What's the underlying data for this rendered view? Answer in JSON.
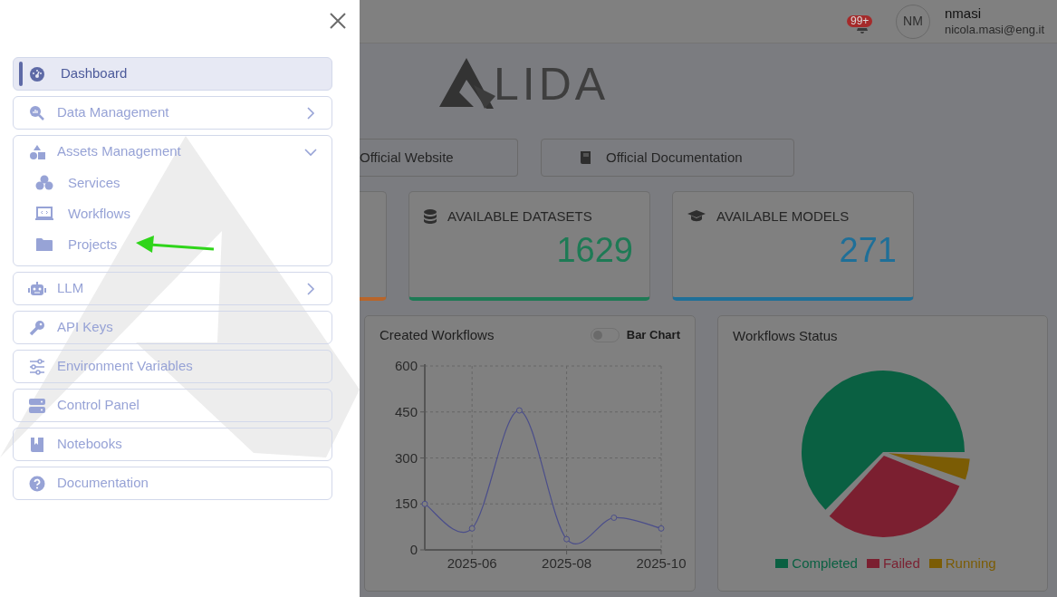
{
  "nav": [
    {
      "label": "Dashboard",
      "selected": true
    },
    {
      "label": "Data Management",
      "selected": false,
      "expandable": true,
      "expanded": false
    },
    {
      "label": "Assets Management",
      "selected": false,
      "expandable": true,
      "expanded": true,
      "children": [
        {
          "label": "Services",
          "selected": false
        },
        {
          "label": "Workflows",
          "selected": false
        },
        {
          "label": "Projects",
          "selected": false
        }
      ]
    },
    {
      "label": "LLM",
      "selected": false,
      "expandable": true,
      "expanded": false
    },
    {
      "label": "API Keys",
      "selected": false
    },
    {
      "label": "Environment Variables",
      "selected": false
    },
    {
      "label": "Control Panel",
      "selected": false
    },
    {
      "label": "Notebooks",
      "selected": false
    },
    {
      "label": "Documentation",
      "selected": false
    }
  ],
  "header": {
    "notification_badge": "99+",
    "avatar_initials": "NM",
    "user_name": "nmasi",
    "user_email": "nicola.masi@eng.it"
  },
  "logo_text": "LIDA",
  "links": [
    "Official Website",
    "Official Documentation"
  ],
  "partial_card": {
    "color": "#b8652a"
  },
  "stats": [
    {
      "title": "AVAILABLE DATASETS",
      "value": "1629",
      "color": "#1e7a55"
    },
    {
      "title": "AVAILABLE MODELS",
      "value": "271",
      "color": "#1f6f98"
    }
  ],
  "workflows_chart": {
    "title": "Created Workflows",
    "toggle": {
      "label": "Bar Chart",
      "on": false
    },
    "chart_data": {
      "type": "line",
      "categories": [
        null,
        "2025-06",
        null,
        "2025-08",
        null,
        "2025-10"
      ],
      "series": [
        {
          "color": "#4b4e8a",
          "marker": "circle",
          "values": [
            150,
            70,
            455,
            35,
            105,
            70
          ]
        }
      ],
      "ylim": [
        0,
        600
      ],
      "yticks": [
        0,
        150,
        300,
        450,
        600
      ],
      "grid": true
    }
  },
  "status_chart": {
    "title": "Workflows Status",
    "legend": [
      {
        "label": "Completed",
        "color": "#0a6042"
      },
      {
        "label": "Failed",
        "color": "#7b1f30"
      },
      {
        "label": "Running",
        "color": "#7b5c05"
      }
    ]
  }
}
